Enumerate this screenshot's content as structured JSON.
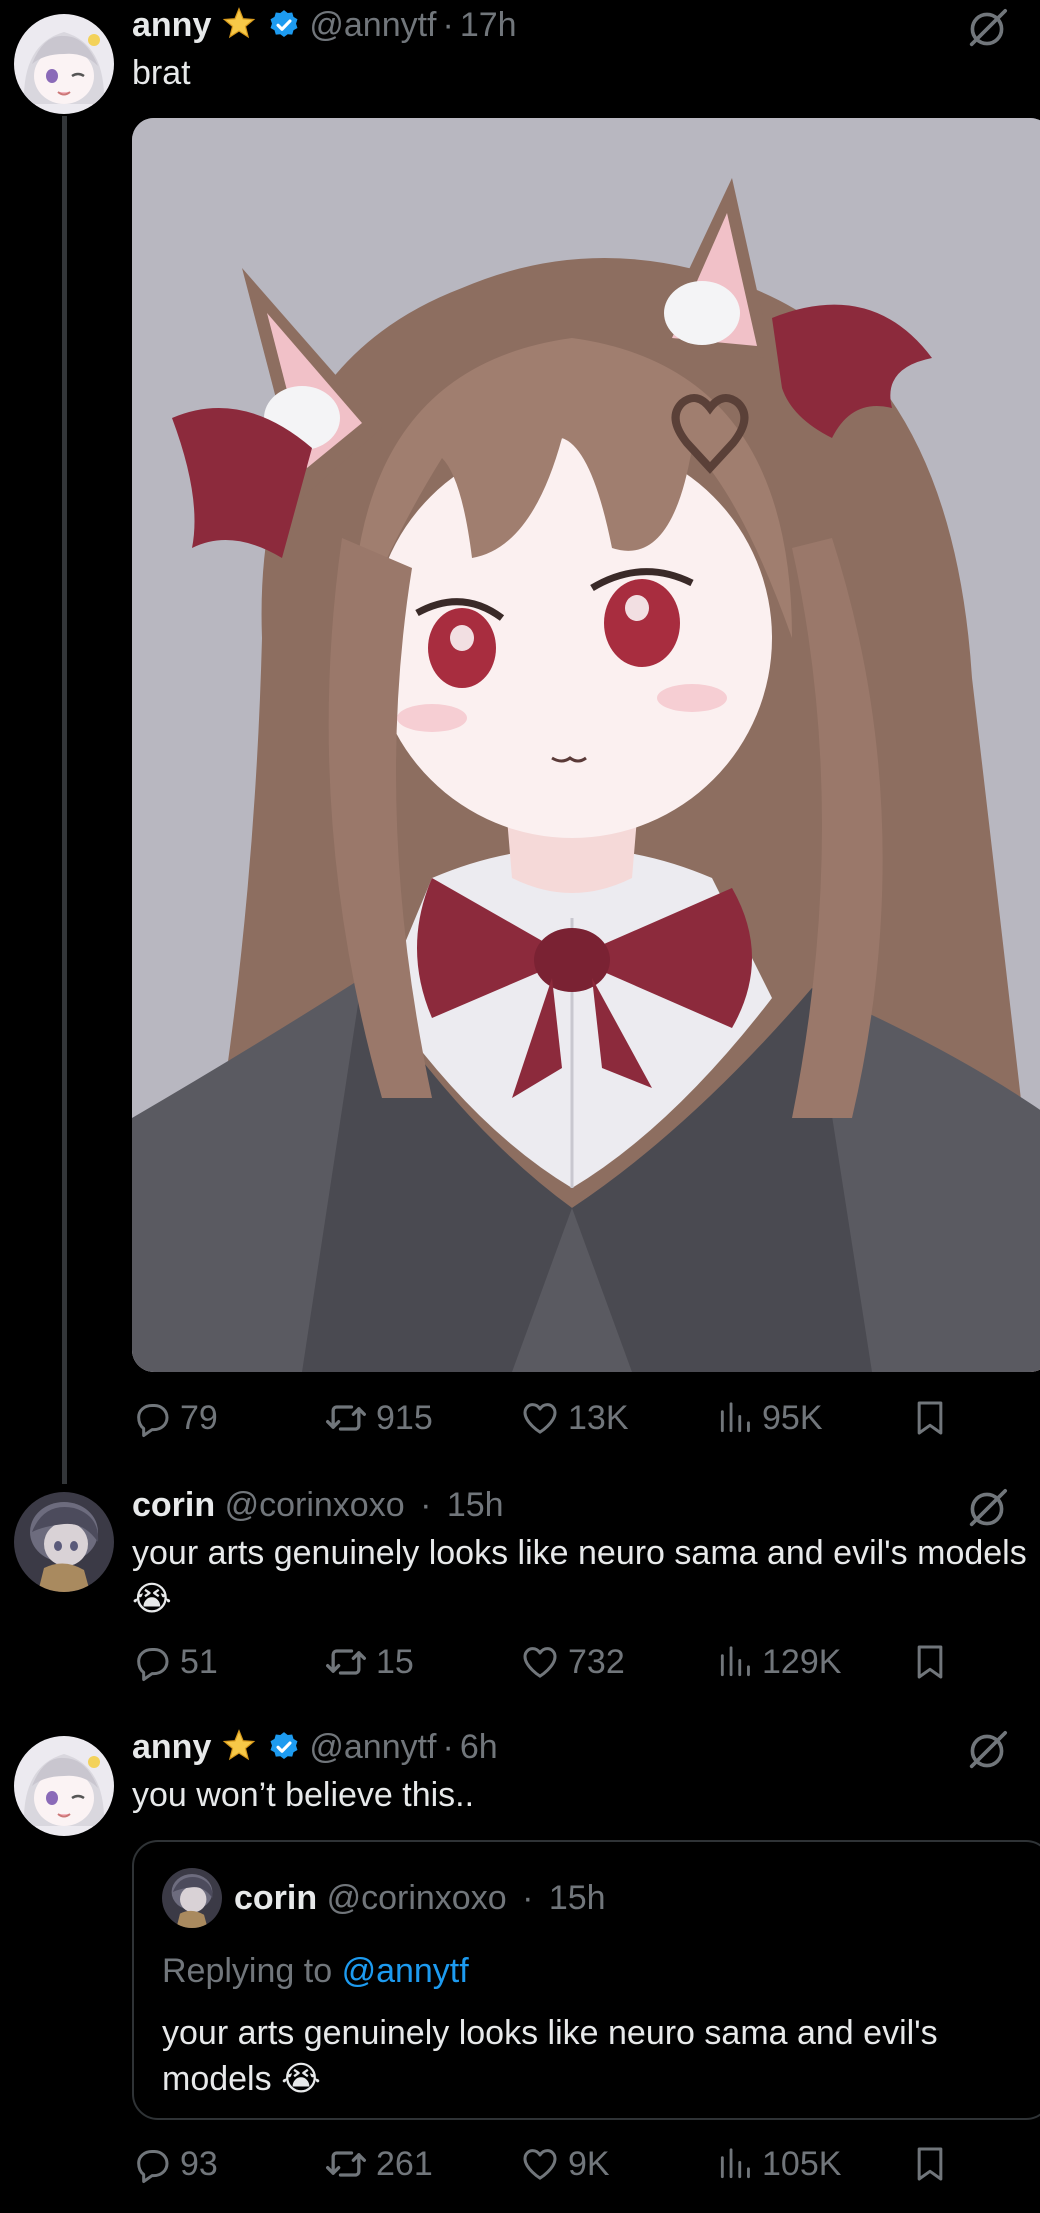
{
  "tweet1": {
    "name": "anny",
    "handle": "@annytf",
    "dot": "·",
    "time": "17h",
    "text": "brat",
    "stats": {
      "replies": "79",
      "reposts": "915",
      "likes": "13K",
      "views": "95K"
    }
  },
  "tweet2": {
    "name": "corin",
    "handle": "@corinxoxo",
    "dot": "·",
    "time": "15h",
    "text": "your arts genuinely looks like neuro sama and evil's models",
    "emoji": "😭",
    "stats": {
      "replies": "51",
      "reposts": "15",
      "likes": "732",
      "views": "129K"
    }
  },
  "tweet3": {
    "name": "anny",
    "handle": "@annytf",
    "dot": "·",
    "time": "6h",
    "text": "you won’t believe this..",
    "quote": {
      "name": "corin",
      "handle": "@corinxoxo",
      "dot": "·",
      "time": "15h",
      "replying_prefix": "Replying to",
      "replying_mention": "@annytf",
      "text": "your arts genuinely looks like neuro sama and evil's models",
      "emoji": "😭"
    },
    "stats": {
      "replies": "93",
      "reposts": "261",
      "likes": "9K",
      "views": "105K"
    }
  },
  "icons": {
    "reply": "reply-icon",
    "repost": "repost-icon",
    "like": "heart-icon",
    "views": "views-icon",
    "bookmark": "bookmark-icon",
    "grok": "grok-icon",
    "verified": "verified-badge-icon",
    "star": "star-badge-icon"
  },
  "colors": {
    "background": "#000000",
    "text": "#e7e9ea",
    "secondary": "#71767b",
    "link": "#1d9bf0",
    "verified": "#1d9bf0",
    "star": "#f7c948"
  }
}
